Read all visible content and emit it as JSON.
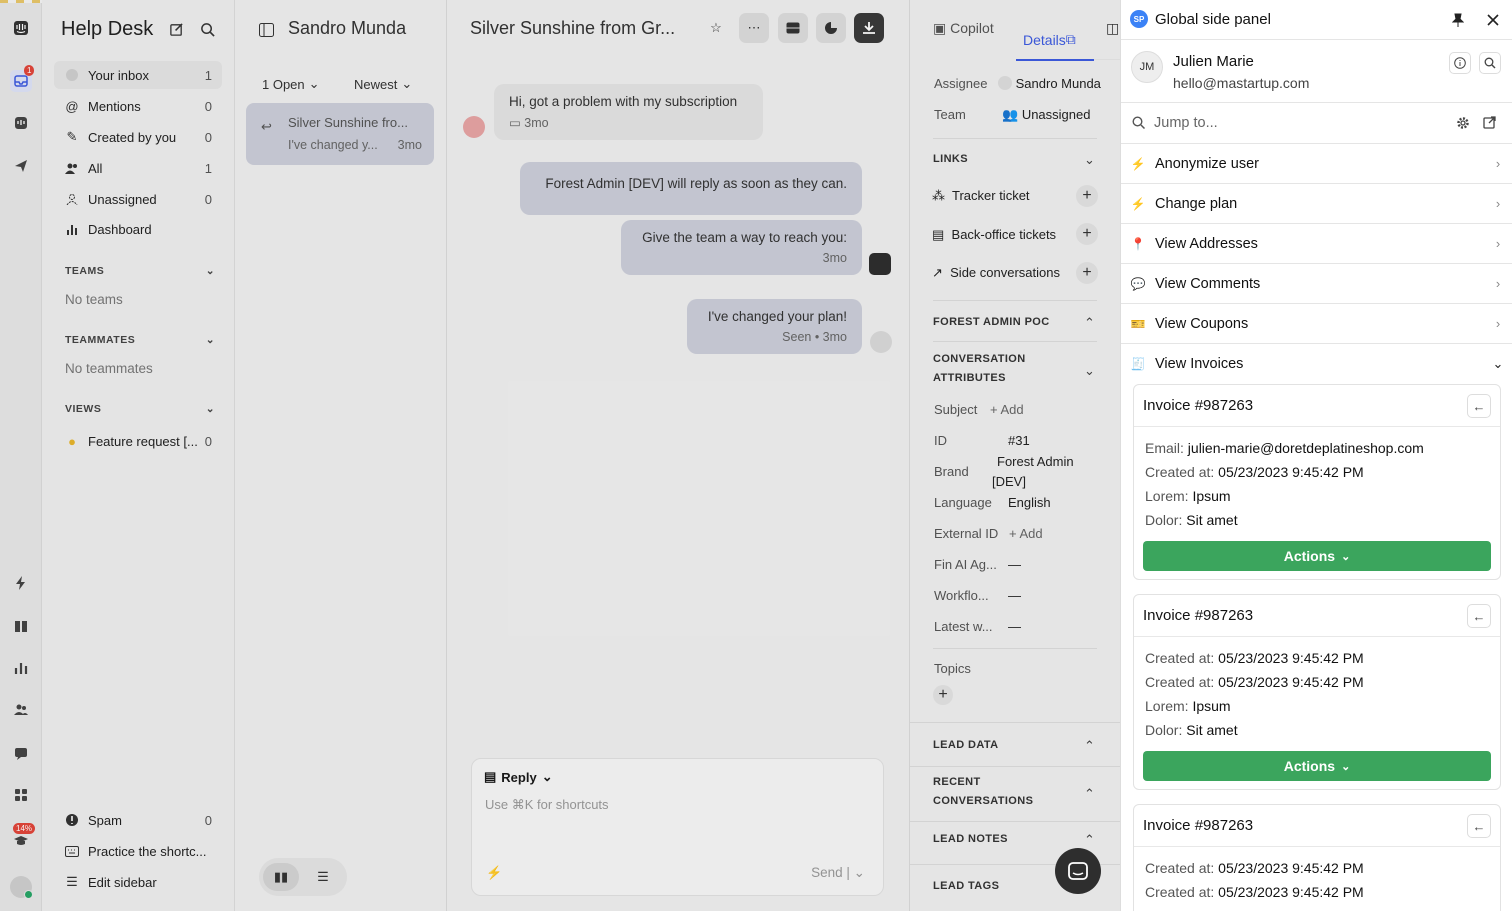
{
  "rail": {
    "inbox_badge": "1",
    "beta_badge": "14%"
  },
  "inbox": {
    "title": "Help Desk",
    "items": [
      {
        "label": "Your inbox",
        "count": "1"
      },
      {
        "label": "Mentions",
        "count": "0"
      },
      {
        "label": "Created by you",
        "count": "0"
      },
      {
        "label": "All",
        "count": "1"
      },
      {
        "label": "Unassigned",
        "count": "0"
      },
      {
        "label": "Dashboard",
        "count": ""
      }
    ],
    "teams_label": "TEAMS",
    "no_teams": "No teams",
    "teammates_label": "TEAMMATES",
    "no_teammates": "No teammates",
    "views_label": "VIEWS",
    "view_item": {
      "label": "Feature request [...",
      "count": "0"
    },
    "bottom": [
      {
        "label": "Spam",
        "count": "0"
      },
      {
        "label": "Practice the shortc...",
        "count": ""
      },
      {
        "label": "Edit sidebar",
        "count": ""
      }
    ]
  },
  "list": {
    "title": "Sandro Munda",
    "filter_open": "1 Open",
    "filter_sort": "Newest",
    "card": {
      "subject": "Silver Sunshine fro...",
      "preview": "I've changed y...",
      "time": "3mo"
    }
  },
  "conversation": {
    "title": "Silver Sunshine from Gr...",
    "messages": [
      {
        "text": "Hi, got a problem with my subscription",
        "meta": "3mo"
      },
      {
        "text": "Forest Admin [DEV] will reply as soon as they can.",
        "meta": ""
      },
      {
        "text": "Give the team a way to reach you:",
        "meta": "3mo"
      },
      {
        "text": "I've changed your plan!",
        "meta": "Seen • 3mo"
      }
    ],
    "composer": {
      "mode": "Reply",
      "placeholder": "Use ⌘K for shortcuts",
      "send": "Send"
    }
  },
  "details": {
    "tab_copilot": "Copilot",
    "tab_details": "Details",
    "assignee_label": "Assignee",
    "assignee": "Sandro Munda",
    "team_label": "Team",
    "team": "Unassigned",
    "links_label": "LINKS",
    "links": [
      "Tracker ticket",
      "Back-office tickets",
      "Side conversations"
    ],
    "poc_label": "FOREST ADMIN POC",
    "attr_label_1": "CONVERSATION",
    "attr_label_2": "ATTRIBUTES",
    "attrs": [
      {
        "k": "Subject",
        "v": "+ Add"
      },
      {
        "k": "ID",
        "v": "#31"
      },
      {
        "k": "Brand",
        "v": "Forest Admin"
      },
      {
        "k": "Language",
        "v": "English"
      },
      {
        "k": "External ID",
        "v": "+ Add"
      },
      {
        "k": "Fin AI Ag...",
        "v": "—"
      },
      {
        "k": "Workflo...",
        "v": "—"
      },
      {
        "k": "Latest w...",
        "v": "—"
      }
    ],
    "brand_line2": "[DEV]",
    "topics_label": "Topics",
    "lead_data": "LEAD DATA",
    "recent_1": "RECENT",
    "recent_2": "CONVERSATIONS",
    "lead_notes": "LEAD NOTES",
    "lead_tags": "LEAD TAGS"
  },
  "panel": {
    "logo": "SP",
    "title": "Global side panel",
    "user": {
      "initials": "JM",
      "name": "Julien Marie",
      "email": "hello@mastartup.com"
    },
    "jump_placeholder": "Jump to...",
    "actions": [
      {
        "label": "Anonymize user",
        "icon": "⚡"
      },
      {
        "label": "Change plan",
        "icon": "⚡"
      },
      {
        "label": "View Addresses",
        "icon": "📍"
      },
      {
        "label": "View Comments",
        "icon": "💬"
      },
      {
        "label": "View Coupons",
        "icon": "🎫"
      },
      {
        "label": "View Invoices",
        "icon": "🧾"
      }
    ],
    "invoices": [
      {
        "title": "Invoice #987263",
        "rows": [
          {
            "k": "Email:",
            "v": "julien-marie@doretdeplatineshop.com"
          },
          {
            "k": "Created at:",
            "v": "05/23/2023 9:45:42 PM"
          },
          {
            "k": "Lorem:",
            "v": "Ipsum"
          },
          {
            "k": "Dolor:",
            "v": "Sit amet"
          }
        ],
        "action": "Actions"
      },
      {
        "title": "Invoice #987263",
        "rows": [
          {
            "k": "Created at:",
            "v": "05/23/2023 9:45:42 PM"
          },
          {
            "k": "Created at:",
            "v": "05/23/2023 9:45:42 PM"
          },
          {
            "k": "Lorem:",
            "v": "Ipsum"
          },
          {
            "k": "Dolor:",
            "v": "Sit amet"
          }
        ],
        "action": "Actions"
      },
      {
        "title": "Invoice #987263",
        "rows": [
          {
            "k": "Created at:",
            "v": "05/23/2023 9:45:42 PM"
          },
          {
            "k": "Created at:",
            "v": "05/23/2023 9:45:42 PM"
          }
        ],
        "action": ""
      }
    ]
  }
}
